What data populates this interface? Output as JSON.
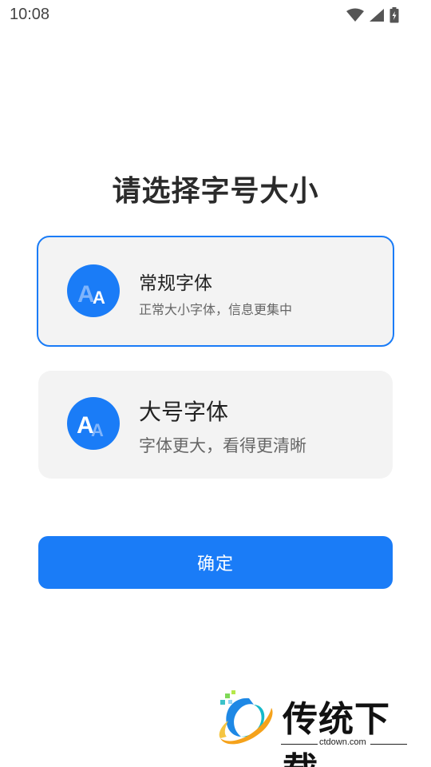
{
  "status_bar": {
    "time": "10:08",
    "icons": [
      "wifi-icon",
      "cellular-signal-icon",
      "battery-charging-icon"
    ]
  },
  "page": {
    "title": "请选择字号大小"
  },
  "options": [
    {
      "id": "regular",
      "title": "常规字体",
      "description": "正常大小字体，信息更集中",
      "icon": "font-size-regular-icon",
      "icon_text": "A",
      "selected": true
    },
    {
      "id": "large",
      "title": "大号字体",
      "description": "字体更大，看得更清晰",
      "icon": "font-size-large-icon",
      "icon_text": "A",
      "selected": false
    }
  ],
  "confirm_button": {
    "label": "确定"
  },
  "watermark": {
    "brand": "传统下载",
    "url": "ctdown.com"
  },
  "colors": {
    "accent": "#1a7cf7",
    "card_background": "#f3f3f3",
    "title_text": "#2b2b2b",
    "secondary_text": "#666666"
  }
}
